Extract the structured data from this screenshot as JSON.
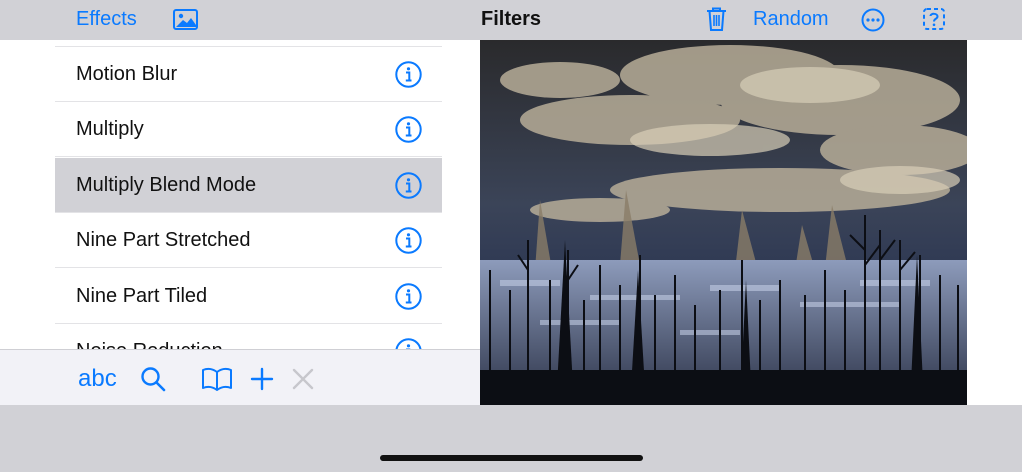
{
  "nav": {
    "effects_label": "Effects",
    "title": "Filters",
    "random_label": "Random",
    "image_icon": "photo-icon",
    "trash_icon": "trash-icon",
    "more_icon": "ellipsis-circle-icon",
    "help_icon": "question-square-icon"
  },
  "filters": {
    "items": [
      {
        "label": "Motion Blur"
      },
      {
        "label": "Multiply"
      },
      {
        "label": "Multiply Blend Mode",
        "selected": true
      },
      {
        "label": "Nine Part Stretched"
      },
      {
        "label": "Nine Part Tiled"
      },
      {
        "label": "Noise Reduction"
      }
    ]
  },
  "toolbar": {
    "abc_label": "abc",
    "icons": [
      "search-icon",
      "book-icon",
      "plus-icon",
      "close-icon"
    ]
  },
  "colors": {
    "accent": "#0a7aff",
    "bar_background": "#d1d1d6",
    "selected_row": "#d1d1d6",
    "disabled": "#c7c7cc"
  }
}
